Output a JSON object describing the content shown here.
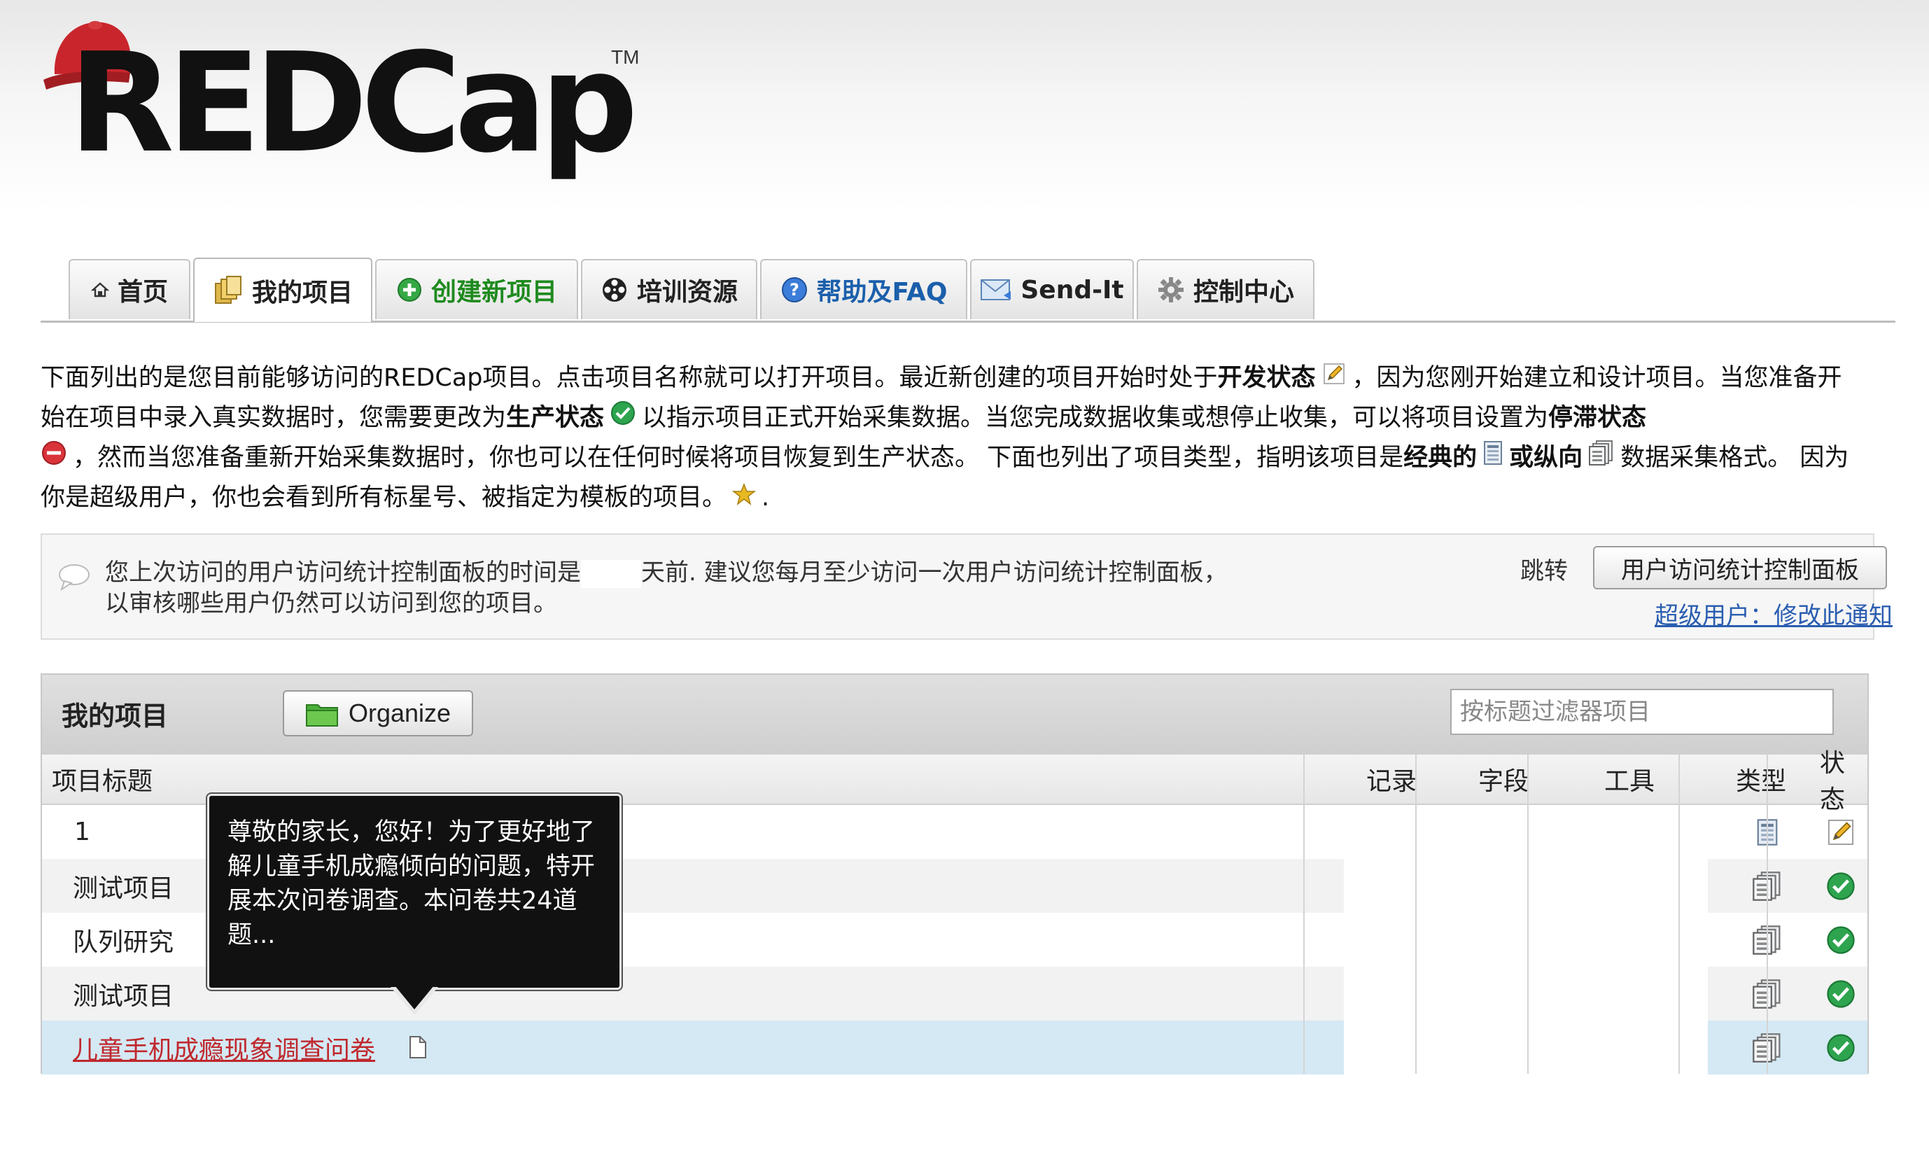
{
  "app": {
    "logo_text": "REDCap",
    "logo_tm": "TM"
  },
  "tabs": [
    {
      "label": "首页",
      "icon": "home-icon"
    },
    {
      "label": "我的项目",
      "icon": "folder-stack-icon",
      "active": true
    },
    {
      "label": "创建新项目",
      "icon": "plus-circle-icon"
    },
    {
      "label": "培训资源",
      "icon": "film-reel-icon"
    },
    {
      "label": "帮助及FAQ",
      "icon": "help-circle-icon"
    },
    {
      "label": "Send-It",
      "icon": "envelope-icon"
    },
    {
      "label": "控制中心",
      "icon": "gear-icon"
    }
  ],
  "intro": {
    "p1": "下面列出的是您目前能够访问的REDCap项目。点击项目名称就可以打开项目。最近新创建的项目开始时处于",
    "dev_state": "开发状态",
    "p2": "，因为您刚开始建立和设计项目。当您准备开始在项目中录入真实数据时，您需要更改为",
    "prod_state": "生产状态",
    "p3": "以指示项目正式开始采集数据。当您完成数据收集或想停止收集，可以将项目设置为",
    "inactive_state": "停滞状态",
    "p4": "，然而当您准备重新开始采集数据时，你也可以在任何时候将项目恢复到生产状态。 下面也列出了项目类型，指明该项目是",
    "classic": "经典的",
    "or": "或",
    "longitudinal": "纵向",
    "p5": "数据采集格式。 因为你是超级用户，你也会看到所有标星号、被指定为模板的项目。",
    "p6": "."
  },
  "notice": {
    "text_a": "您上次访问的用户访问统计控制面板的时间是",
    "text_b": "天前. 建议您每月至少访问一次用户访问统计控制面板，",
    "text_c": "以审核哪些用户仍然可以访问到您的项目。",
    "jump_label": "跳转",
    "button_label": "用户访问统计控制面板",
    "link_label": "超级用户：修改此通知"
  },
  "projects": {
    "title": "我的项目",
    "organize_label": "Organize",
    "filter_placeholder": "按标题过滤器项目",
    "columns": {
      "title": "项目标题",
      "records": "记录",
      "fields": "字段",
      "tools": "工具",
      "type": "类型",
      "status": "状态"
    },
    "rows": [
      {
        "title": "1",
        "type": "classic",
        "status": "development"
      },
      {
        "title": "测试项目",
        "type": "longitudinal",
        "status": "production"
      },
      {
        "title": "队列研究",
        "type": "longitudinal",
        "status": "production"
      },
      {
        "title": "测试项目",
        "type": "longitudinal",
        "status": "production"
      },
      {
        "title": "儿童手机成瘾现象调查问卷",
        "type": "longitudinal",
        "status": "production",
        "selected": true
      }
    ]
  },
  "tooltip": {
    "text": "尊敬的家长，您好！为了更好地了解儿童手机成瘾倾向的问题，特开展本次问卷调查。本问卷共24道题..."
  },
  "colors": {
    "accent_red": "#c0282d",
    "link_blue": "#2a5db0",
    "production_green": "#2ea44f",
    "inactive_red": "#d9343a",
    "selected_row": "#d4e9f4"
  }
}
